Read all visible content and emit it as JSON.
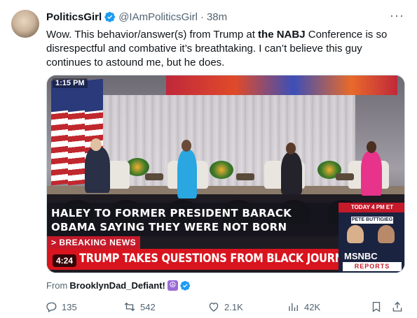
{
  "tweet": {
    "author_name": "PoliticsGirl",
    "author_handle": "@IAmPoliticsGirl",
    "separator": "·",
    "time": "38m",
    "text_before": "Wow. This behavior/answer(s) from Trump at ",
    "text_bold": "the NABJ",
    "text_after": " Conference is so disrespectful and combative it’s breathtaking. I can’t believe this guy continues to astound me, but he does."
  },
  "video": {
    "clock": "1:15 PM",
    "headline": "HALEY TO FORMER PRESIDENT BARACK OBAMA SAYING THEY WERE NOT BORN",
    "breaking_label": "> BREAKING NEWS",
    "banner_text": "TRUMP TAKES QUESTIONS FROM BLACK JOURNALISTS",
    "duration": "4:24",
    "promo_time": "TODAY 4 PM ET",
    "promo_name": "PETE BUTTIGIEG",
    "network": "MSNBC",
    "network_sub": "REPORTS"
  },
  "attribution": {
    "prefix": "From",
    "user": "BrooklynDad_Defiant!",
    "emoji": "☮"
  },
  "actions": {
    "replies": "135",
    "reposts": "542",
    "likes": "2.1K",
    "views": "42K"
  },
  "colors": {
    "verified": "#1d9bf0",
    "text_secondary": "#536471",
    "breaking_red": "#d8141e",
    "msnbc_navy": "#1a2340"
  },
  "icons": [
    "verified-badge-icon",
    "more-icon",
    "reply-icon",
    "repost-icon",
    "like-icon",
    "views-icon",
    "bookmark-icon",
    "share-icon"
  ]
}
